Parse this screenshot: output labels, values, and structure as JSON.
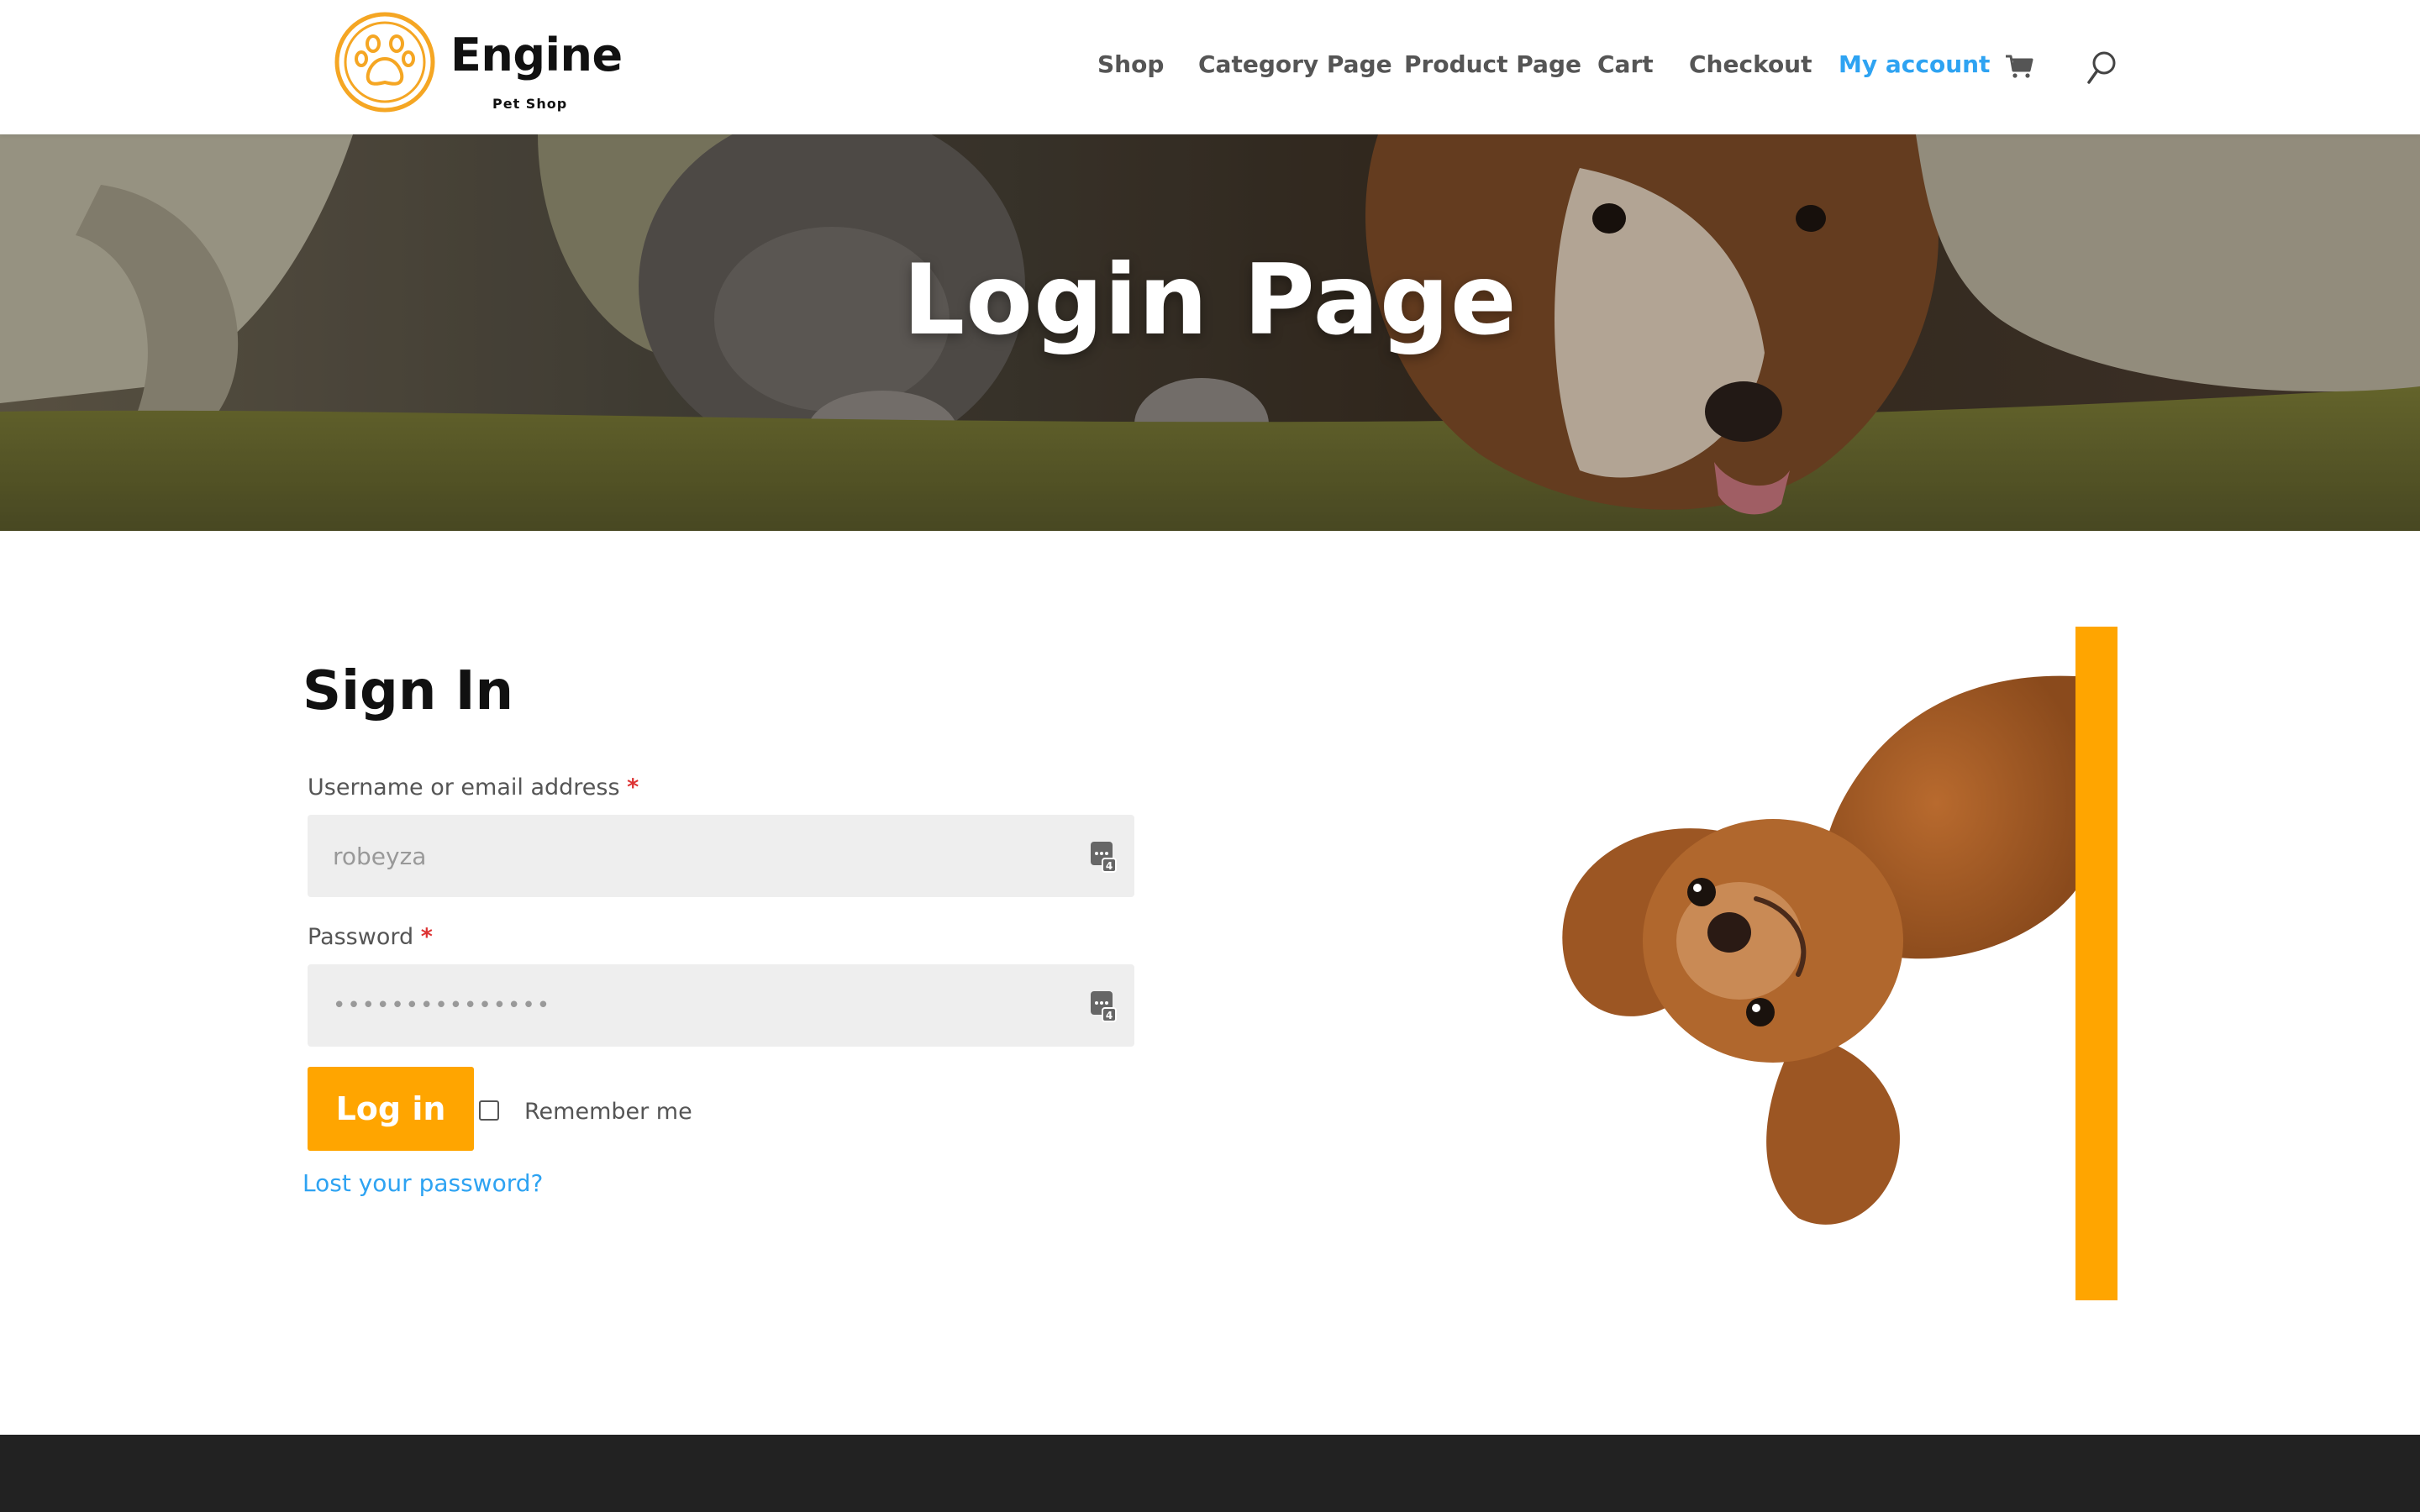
{
  "header": {
    "logo": {
      "name": "Engine",
      "subtitle": "Pet Shop",
      "icon": "paw-icon",
      "color": "#F5A623"
    },
    "nav": [
      {
        "label": "Shop",
        "active": false
      },
      {
        "label": "Category Page",
        "active": false
      },
      {
        "label": "Product Page",
        "active": false
      },
      {
        "label": "Cart",
        "active": false
      },
      {
        "label": "Checkout",
        "active": false
      },
      {
        "label": "My account",
        "active": true
      }
    ],
    "cart_icon": "cart-icon",
    "search_icon": "search-icon",
    "active_color": "#2EA3F2"
  },
  "hero": {
    "title": "Login Page"
  },
  "signin": {
    "title": "Sign In",
    "username_label": "Username or email address",
    "username_value": "robeyza",
    "password_label": "Password",
    "password_value": "•••••••••••••••",
    "required_mark": "*",
    "field_icon": "password-manager-icon",
    "login_button": "Log in",
    "remember_label": "Remember me",
    "remember_checked": false,
    "lost_password": "Lost your password?"
  },
  "colors": {
    "accent": "#FFA500",
    "link": "#2EA3F2",
    "footer": "#222222",
    "required": "#DD3333"
  }
}
